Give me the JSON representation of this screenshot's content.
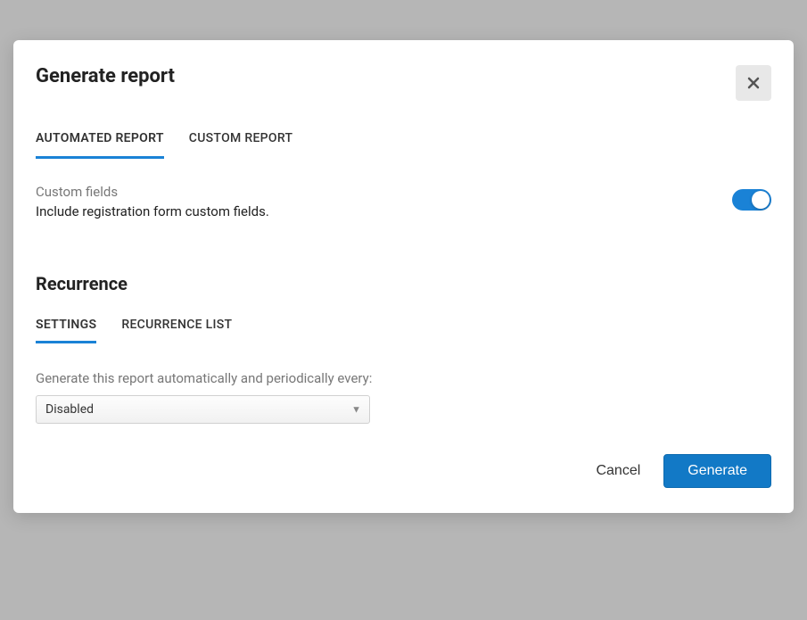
{
  "modal": {
    "title": "Generate report",
    "tabs": {
      "automated": "AUTOMATED REPORT",
      "custom": "CUSTOM REPORT"
    },
    "customFields": {
      "label": "Custom fields",
      "desc": "Include registration form custom fields.",
      "toggle": true
    },
    "recurrence": {
      "title": "Recurrence",
      "tabs": {
        "settings": "SETTINGS",
        "list": "RECURRENCE LIST"
      },
      "label": "Generate this report automatically and periodically every:",
      "selected": "Disabled"
    },
    "actions": {
      "cancel": "Cancel",
      "generate": "Generate"
    }
  }
}
